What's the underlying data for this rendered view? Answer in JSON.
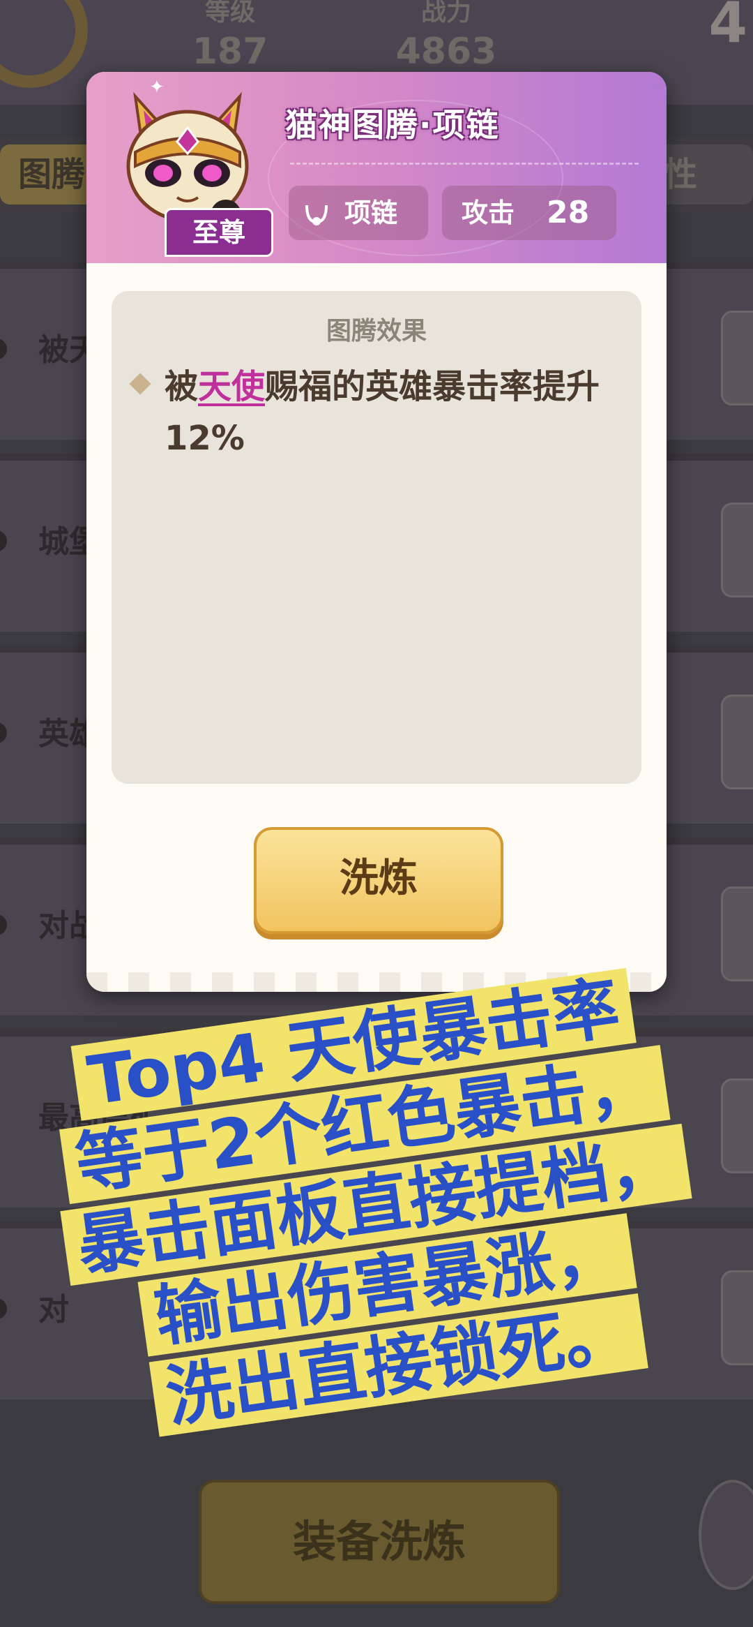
{
  "background": {
    "stats": [
      {
        "label": "等级",
        "value": "187"
      },
      {
        "label": "战力",
        "value": "4863"
      }
    ],
    "corner_number": "4",
    "tab_left": "图腾",
    "tab_right": "属性",
    "rows": [
      "被天",
      "城堡",
      "英雄",
      "对战",
      "最高层矿",
      "对"
    ],
    "bottom_button": "装备洗炼"
  },
  "popup": {
    "title": "猫神图腾·项链",
    "rank": "至尊",
    "type_label": "项链",
    "attack_label": "攻击",
    "attack_value": "28",
    "effect_title": "图腾效果",
    "effect_pre": "被",
    "effect_highlight": "天使",
    "effect_post": "赐福的英雄暴击率提升12%",
    "refine_button": "洗炼"
  },
  "caption": {
    "lines": [
      "Top4 天使暴击率",
      "等于2个红色暴击，",
      "暴击面板直接提档，",
      "输出伤害暴涨，",
      "洗出直接锁死。"
    ]
  },
  "colors": {
    "header_gradient_start": "#e6a0c8",
    "header_gradient_end": "#b37ad4",
    "highlight": "#c0309c",
    "button": "#f1c45f",
    "caption_bg": "#f2e36b",
    "caption_text": "#2a50c8"
  }
}
